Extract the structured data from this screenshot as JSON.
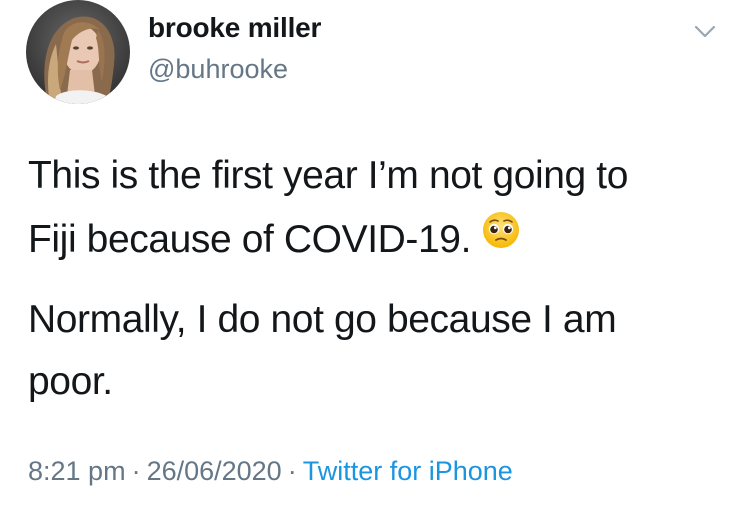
{
  "author": {
    "name": "brooke miller",
    "handle": "@buhrooke"
  },
  "tweet": {
    "line1": "This is the first year I’m not going to",
    "line2": "Fiji because of COVID-19.",
    "line3": "Normally, I do not go because I am",
    "line4": "poor.",
    "emoji": "pleading-face-emoji"
  },
  "meta": {
    "time": "8:21 pm",
    "separator": "·",
    "date": "26/06/2020",
    "source": "Twitter for iPhone"
  },
  "colors": {
    "text": "#14171a",
    "secondary": "#657786",
    "link": "#1b95e0"
  },
  "icons": {
    "caret": "chevron-down-icon"
  }
}
